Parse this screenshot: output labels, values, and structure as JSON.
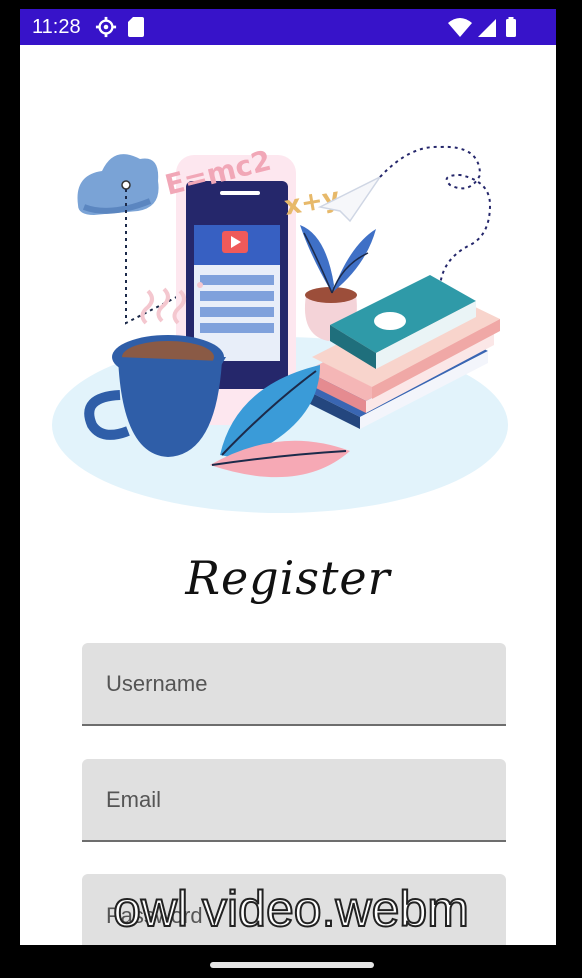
{
  "status_bar": {
    "time": "11:28",
    "icons": [
      "settings-icon",
      "sd-card-icon",
      "wifi-icon",
      "signal-icon",
      "battery-icon"
    ],
    "background_color": "#3713c9"
  },
  "hero": {
    "formula_text": "E=mc2",
    "xy_text": "x+y",
    "icon": "study-illustration"
  },
  "title": "Register",
  "form": {
    "username_placeholder": "Username",
    "email_placeholder": "Email",
    "password_placeholder": "Password"
  },
  "watermark": "owl video.webm"
}
